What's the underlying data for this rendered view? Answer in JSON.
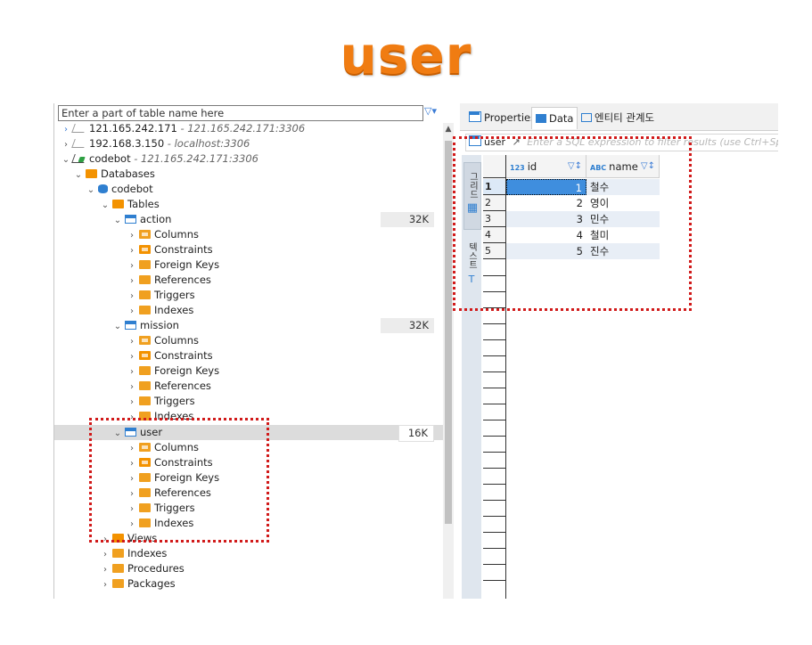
{
  "page_title": "user",
  "navigator": {
    "filter_placeholder": "Enter a part of table name here",
    "connections": [
      {
        "name": "121.165.242.171",
        "detail": "- 121.165.242.171:3306"
      },
      {
        "name": "192.168.3.150",
        "detail": "- localhost:3306"
      },
      {
        "name": "codebot",
        "detail": "- 121.165.242.171:3306"
      }
    ],
    "databases_label": "Databases",
    "db_name": "codebot",
    "tables_label": "Tables",
    "tables": [
      {
        "name": "action",
        "size": "32K"
      },
      {
        "name": "mission",
        "size": "32K"
      },
      {
        "name": "user",
        "size": "16K"
      }
    ],
    "table_children": [
      "Columns",
      "Constraints",
      "Foreign Keys",
      "References",
      "Triggers",
      "Indexes"
    ],
    "db_folders": [
      "Views",
      "Indexes",
      "Procedures",
      "Packages"
    ]
  },
  "editor": {
    "tabs": [
      "Properties",
      "Data",
      "엔티티 관계도"
    ],
    "active_tab": "Data",
    "filter_table": "user",
    "filter_placeholder": "Enter a SQL expression to filter results (use Ctrl+Space",
    "side_tabs": {
      "grid": "그리드",
      "text": "텍스트"
    },
    "columns": [
      {
        "name": "id",
        "type_icon": "123"
      },
      {
        "name": "name",
        "type_icon": "ABC"
      }
    ],
    "rows": [
      {
        "num": "1",
        "id": "1",
        "name": "철수"
      },
      {
        "num": "2",
        "id": "2",
        "name": "영이"
      },
      {
        "num": "3",
        "id": "3",
        "name": "민수"
      },
      {
        "num": "4",
        "id": "4",
        "name": "철미"
      },
      {
        "num": "5",
        "id": "5",
        "name": "진수"
      }
    ]
  },
  "colors": {
    "title": "#f07c12",
    "highlight_box": "#d11a1a",
    "folder": "#f0a020",
    "table_icon": "#2f7fd0",
    "selected_cell": "#3f8ede"
  }
}
